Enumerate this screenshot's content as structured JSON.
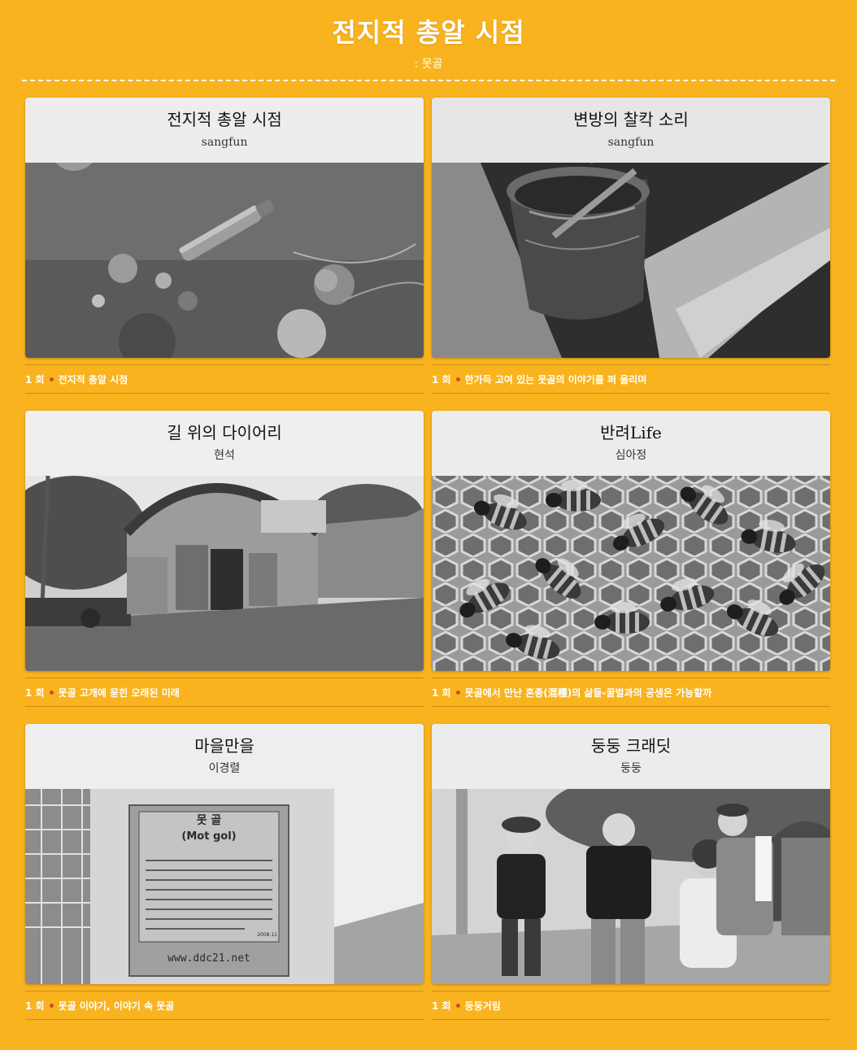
{
  "header": {
    "title": "전지적 총알 시점",
    "subtitle": ": 못골"
  },
  "colors": {
    "background": "#f9b31e",
    "episode_dot": "#c8501e",
    "header_overlay": "#f0f0f0"
  },
  "cards": [
    {
      "title": "전지적 총알 시점",
      "author": "sangfun",
      "episode_number": "1 회",
      "episode_title": "전지적 총알 시점",
      "image": "bullet-in-dirt-photo"
    },
    {
      "title": "변방의 찰칵 소리",
      "author": "sangfun",
      "episode_number": "1 회",
      "episode_title": "한가득 고여 있는 못골의 이야기를 퍼 올리며",
      "image": "water-bucket-photo"
    },
    {
      "title": "길 위의 다이어리",
      "author": "현석",
      "episode_number": "1 회",
      "episode_title": "못골 고개에 묻힌 오래된 미래",
      "image": "greenhouse-shed-photo"
    },
    {
      "title": "반려Life",
      "author": "심아정",
      "episode_number": "1 회",
      "episode_title": "못골에서 만난 혼종(混種)의 삶들-꿀벌과의 공생은 가능할까",
      "image": "honeybees-photo"
    },
    {
      "title": "마을만을",
      "author": "이경렬",
      "episode_number": "1 회",
      "episode_title": "못골 이야기, 이야기 속 못골",
      "image": "village-sign-photo",
      "sign_heading": "못 골",
      "sign_roman": "(Mot gol)",
      "sign_date": "2008.11",
      "sign_url": "www.ddc21.net"
    },
    {
      "title": "둥둥 크래딧",
      "author": "둥둥",
      "episode_number": "1 회",
      "episode_title": "둥둥거림",
      "image": "people-walking-photo"
    }
  ]
}
